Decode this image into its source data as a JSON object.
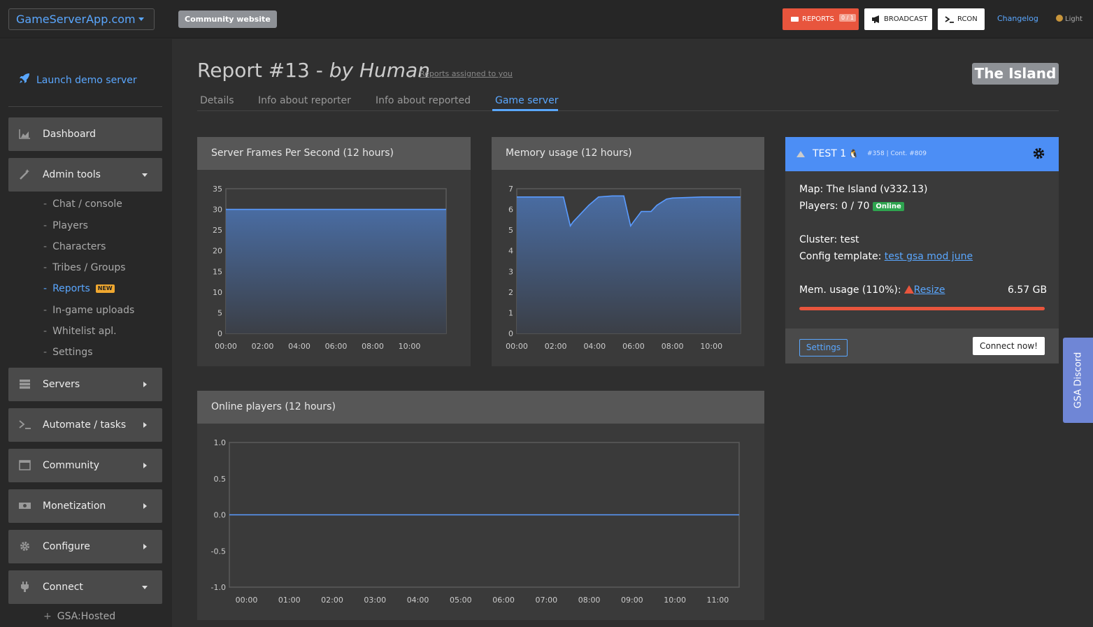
{
  "topbar": {
    "brand": "GameServerApp.com",
    "community_website": "Community website",
    "reports_label": "REPORTS",
    "reports_count": "0 / 1",
    "broadcast_label": "BROADCAST",
    "rcon_label": "RCON",
    "changelog_label": "Changelog",
    "theme_label": "Light"
  },
  "sidebar": {
    "launch_demo": "Launch demo server",
    "dashboard": "Dashboard",
    "admin_tools": "Admin tools",
    "admin_subitems": [
      "Chat / console",
      "Players",
      "Characters",
      "Tribes / Groups",
      "Reports",
      "In-game uploads",
      "Whitelist apl.",
      "Settings"
    ],
    "new_badge": "NEW",
    "servers": "Servers",
    "automate": "Automate / tasks",
    "community": "Community",
    "monetization": "Monetization",
    "configure": "Configure",
    "connect": "Connect",
    "connect_subitems": [
      "GSA:Hosted"
    ]
  },
  "header": {
    "title": "Report #13 - ",
    "by": "by Human",
    "assigned_link": "Reports assigned to you",
    "map_badge": "The Island"
  },
  "tabs": [
    "Details",
    "Info about reporter",
    "Info about reported",
    "Game server"
  ],
  "panels": {
    "fps_title": "Server Frames Per Second (12 hours)",
    "memory_title": "Memory usage (12 hours)",
    "players_title": "Online players (12 hours)"
  },
  "server_card": {
    "name": "TEST 1",
    "meta": "#358 | Cont. #809",
    "map_line": "Map: The Island (v332.13)",
    "players_line": "Players: 0 / 70",
    "online_badge": "Online",
    "cluster_line": "Cluster: test",
    "config_label": "Config template: ",
    "config_link": "test gsa mod june",
    "mem_label": "Mem. usage (110%):",
    "resize_link": "Resize",
    "mem_size": "6.57 GB",
    "mem_percent": 110,
    "settings_btn": "Settings",
    "connect_btn": "Connect now!"
  },
  "discord_tab": "GSA Discord",
  "colors": {
    "accent": "#5aa7ff",
    "card_header": "#4c8ef5",
    "danger": "#e8553d",
    "online": "#2ea44f"
  },
  "chart_data": [
    {
      "type": "area",
      "title": "Server Frames Per Second (12 hours)",
      "categories": [
        "00:00",
        "02:00",
        "04:00",
        "06:00",
        "08:00",
        "10:00"
      ],
      "yticks": [
        0,
        5,
        10,
        15,
        20,
        25,
        30,
        35
      ],
      "ylim": [
        0,
        35
      ],
      "xlim": [
        0,
        12
      ],
      "series": [
        {
          "x": [
            0,
            1,
            2,
            3,
            4,
            5,
            6,
            7,
            8,
            9,
            10,
            11,
            12
          ],
          "values": [
            30,
            30,
            30,
            30,
            30,
            30,
            30,
            30,
            30,
            30,
            30,
            30,
            30
          ]
        }
      ]
    },
    {
      "type": "area",
      "title": "Memory usage (12 hours)",
      "categories": [
        "00:00",
        "02:00",
        "04:00",
        "06:00",
        "08:00",
        "10:00"
      ],
      "yticks": [
        0,
        1,
        2,
        3,
        4,
        5,
        6,
        7
      ],
      "ylim": [
        0,
        7
      ],
      "xlim": [
        0,
        11.5
      ],
      "series": [
        {
          "x": [
            0,
            2.4,
            2.75,
            2.9,
            3.3,
            3.7,
            4.2,
            4.9,
            5.5,
            5.85,
            6.0,
            6.4,
            6.9,
            7.2,
            7.7,
            8.0,
            9.5,
            11.5
          ],
          "values": [
            6.6,
            6.6,
            5.2,
            5.4,
            5.8,
            6.2,
            6.6,
            6.65,
            6.65,
            5.2,
            5.4,
            5.9,
            5.9,
            6.2,
            6.5,
            6.55,
            6.6,
            6.6
          ]
        }
      ]
    },
    {
      "type": "line",
      "title": "Online players (12 hours)",
      "categories": [
        "00:00",
        "01:00",
        "02:00",
        "03:00",
        "04:00",
        "05:00",
        "06:00",
        "07:00",
        "08:00",
        "09:00",
        "10:00",
        "11:00"
      ],
      "yticks": [
        -1.0,
        -0.5,
        0.0,
        0.5,
        1.0
      ],
      "ylim": [
        -1,
        1
      ],
      "xlim": [
        -0.4,
        11.5
      ],
      "series": [
        {
          "x": [
            -0.4,
            11.5
          ],
          "values": [
            0,
            0
          ]
        }
      ]
    }
  ]
}
